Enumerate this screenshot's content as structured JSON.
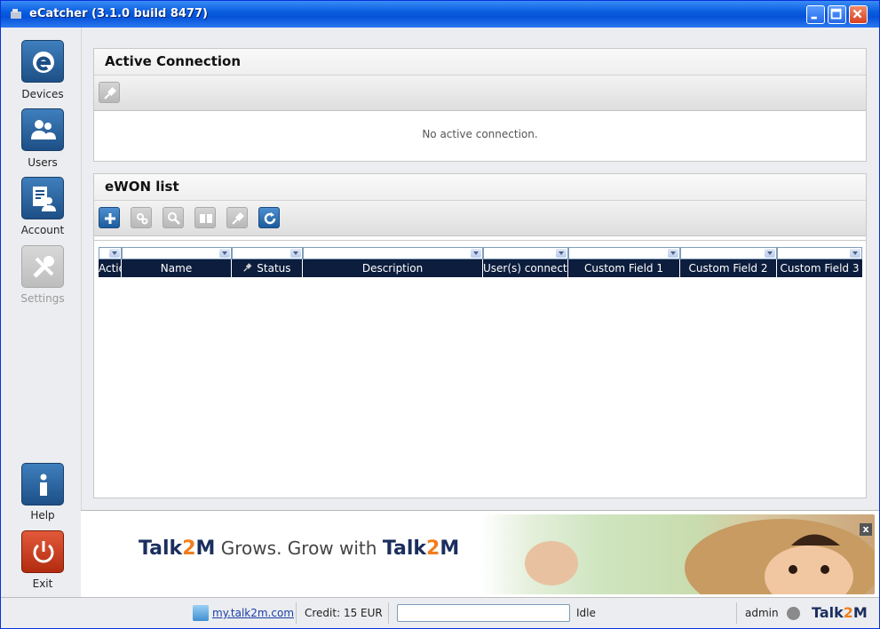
{
  "window": {
    "title": "eCatcher  (3.1.0 build 8477)"
  },
  "sidebar": {
    "items": [
      {
        "label": "Devices",
        "icon": "ewon-logo-icon",
        "enabled": true
      },
      {
        "label": "Users",
        "icon": "users-icon",
        "enabled": true
      },
      {
        "label": "Account",
        "icon": "account-icon",
        "enabled": true
      },
      {
        "label": "Settings",
        "icon": "tools-icon",
        "enabled": false
      },
      {
        "label": "Help",
        "icon": "info-icon",
        "enabled": true
      },
      {
        "label": "Exit",
        "icon": "power-icon",
        "enabled": true
      }
    ]
  },
  "active_connection": {
    "title": "Active Connection",
    "message": "No active connection."
  },
  "ewon_list": {
    "title": "eWON list",
    "columns": [
      "Actio",
      "Name",
      "Status",
      "Description",
      "User(s) connecte",
      "Custom Field 1",
      "Custom Field 2",
      "Custom Field 3"
    ],
    "rows": []
  },
  "banner": {
    "brand_prefix": "Talk",
    "brand_num": "2",
    "brand_suffix": "M",
    "tagline": " Grows. Grow with ",
    "close": "x"
  },
  "statusbar": {
    "link": "my.talk2m.com",
    "credit": "Credit: 15 EUR",
    "state": "Idle",
    "user": "admin",
    "logo_prefix": "Talk",
    "logo_num": "2",
    "logo_suffix": "M"
  },
  "colors": {
    "titlebar": "#0552d8",
    "accent_blue": "#1d5c9e",
    "grid_header": "#0c1d3d",
    "exit_red": "#b22c10",
    "brand_orange": "#f07e1d"
  }
}
